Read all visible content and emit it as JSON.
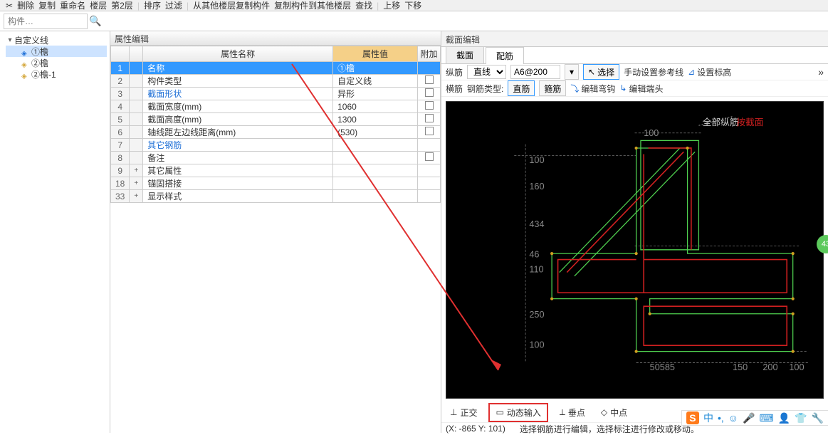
{
  "toolbar": {
    "items": [
      "删除",
      "复制",
      "重命名",
      "楼层",
      "第2层",
      "排序",
      "过滤",
      "从其他楼层复制构件",
      "复制构件到其他楼层",
      "查找",
      "上移",
      "下移"
    ]
  },
  "search": {
    "placeholder": "构件…"
  },
  "tree": {
    "root": "自定义线",
    "items": [
      "①檐",
      "②檐",
      "②檐-1"
    ]
  },
  "props": {
    "title": "属性编辑",
    "col_name": "属性名称",
    "col_val": "属性值",
    "col_add": "附加",
    "rows": [
      {
        "n": "1",
        "name": "名称",
        "val": "①檐",
        "sel": true,
        "link": false,
        "chk": false
      },
      {
        "n": "2",
        "name": "构件类型",
        "val": "自定义线",
        "chk": true
      },
      {
        "n": "3",
        "name": "截面形状",
        "val": "异形",
        "link": true,
        "chk": true
      },
      {
        "n": "4",
        "name": "截面宽度(mm)",
        "val": "1060",
        "chk": true
      },
      {
        "n": "5",
        "name": "截面高度(mm)",
        "val": "1300",
        "chk": true
      },
      {
        "n": "6",
        "name": "轴线距左边线距离(mm)",
        "val": "(530)",
        "chk": true
      },
      {
        "n": "7",
        "name": "其它钢筋",
        "val": "",
        "link": true,
        "chk": false
      },
      {
        "n": "8",
        "name": "备注",
        "val": "",
        "chk": true
      },
      {
        "n": "9",
        "name": "其它属性",
        "val": "",
        "exp": "+",
        "chk": false
      },
      {
        "n": "18",
        "name": "锚固搭接",
        "val": "",
        "exp": "+",
        "chk": false
      },
      {
        "n": "33",
        "name": "显示样式",
        "val": "",
        "exp": "+",
        "chk": false
      }
    ]
  },
  "section": {
    "title": "截面编辑",
    "tab1": "截面",
    "tab2": "配筋",
    "row1": {
      "longi": "纵筋",
      "line_sel": "直线",
      "spec": "A6@200",
      "select_btn": "选择",
      "manual": "手动设置参考线",
      "set_elev": "设置标高"
    },
    "row2": {
      "trans": "横筋",
      "rtype": "钢筋类型:",
      "straight": "直筋",
      "stirrup": "箍筋",
      "edit_hook": "编辑弯钩",
      "edit_end": "编辑端头"
    },
    "canvas_labels": {
      "all_layer": "全部纵筋",
      "by_sec": "按截面"
    },
    "dims": {
      "d1": "100",
      "d2": "160",
      "d3": "434",
      "d4": "46",
      "d5": "110",
      "d6": "250",
      "d7": "100",
      "d8": "100",
      "d9": "150",
      "d10": "200",
      "d11": "100",
      "db": "50585"
    }
  },
  "snaps": {
    "ortho": "正交",
    "dyn": "动态输入",
    "perp": "垂点",
    "mid": "中点"
  },
  "status": {
    "coord": "(X: -865 Y: 101)",
    "hint": "选择钢筋进行编辑，选择标注进行修改或移动。"
  },
  "badge": "43",
  "ime": {
    "s": "S",
    "zh": "中"
  }
}
